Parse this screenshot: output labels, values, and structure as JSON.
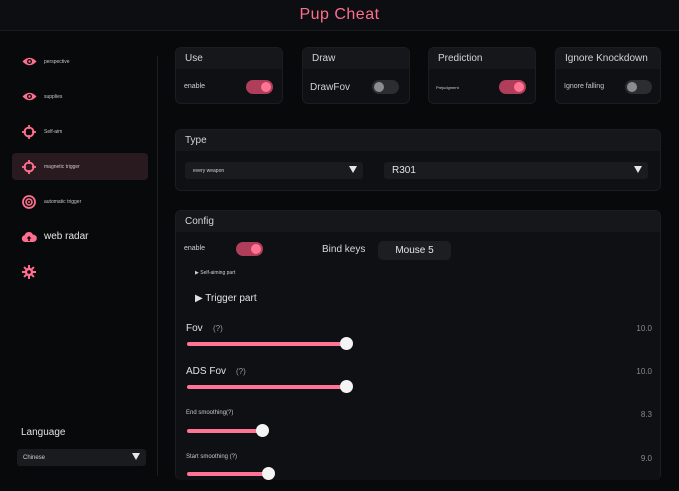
{
  "app": {
    "title": "Pup Cheat",
    "accent": "#ff7494"
  },
  "sidebar": {
    "items": [
      {
        "label": "perspective",
        "icon": "eye-icon"
      },
      {
        "label": "supplies",
        "icon": "eye-icon"
      },
      {
        "label": "Self-aim",
        "icon": "crosshair-icon"
      },
      {
        "label": "magnetic trigger",
        "icon": "crosshair-icon"
      },
      {
        "label": "automatic trigger",
        "icon": "target-icon"
      },
      {
        "label": "web radar",
        "icon": "cloud-upload-icon"
      },
      {
        "label": "",
        "icon": "gear-icon"
      }
    ],
    "active_index": 3,
    "language_title": "Language",
    "language_value": "Chinese"
  },
  "top_panels": {
    "use": {
      "title": "Use",
      "label": "enable",
      "on": true
    },
    "draw": {
      "title": "Draw",
      "label": "DrawFov",
      "on": false
    },
    "prediction": {
      "title": "Prediction",
      "label": "Prejudgment",
      "on": true
    },
    "ignore": {
      "title": "Ignore Knockdown",
      "label": "Ignore falling",
      "on": false
    }
  },
  "type_panel": {
    "title": "Type",
    "weapon_group": "every weapon",
    "weapon": "R301"
  },
  "config": {
    "title": "Config",
    "enable_label": "enable",
    "enable_on": true,
    "bind_label": "Bind keys",
    "bind_value": "Mouse 5",
    "self_aiming_part": "▶ Self-aiming part",
    "trigger_part": "▶ Trigger part",
    "sliders": [
      {
        "label": "Fov",
        "help": "(?)",
        "value": "10.0",
        "fraction": 1.0
      },
      {
        "label": "ADS Fov",
        "help": "(?)",
        "value": "10.0",
        "fraction": 1.0
      },
      {
        "label": "End smoothing(?)",
        "help": "",
        "value": "8.3",
        "fraction": 0.47
      },
      {
        "label": "Start smoothing (?)",
        "help": "",
        "value": "9.0",
        "fraction": 0.51
      }
    ]
  }
}
